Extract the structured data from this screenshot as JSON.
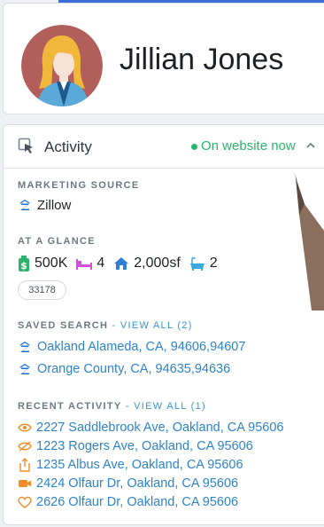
{
  "profile": {
    "name": "Jillian Jones"
  },
  "activity": {
    "title": "Activity",
    "status": "On website now",
    "status_color": "#29b36b",
    "marketing_source": {
      "label": "MARKETING SOURCE",
      "value": "Zillow",
      "icon": "zillow-icon"
    },
    "at_a_glance": {
      "label": "AT A GLANCE",
      "price": "500K",
      "beds": "4",
      "sqft": "2,000sf",
      "baths": "2",
      "zip": "33178"
    },
    "saved_search": {
      "label": "SAVED SEARCH",
      "view_all": " - VIEW ALL (2)",
      "items": [
        "Oakland Alameda, CA, 94606,94607",
        "Orange County, CA, 94635,94636"
      ]
    },
    "recent_activity": {
      "label": "RECENT ACTIVITY",
      "view_all": " - VIEW ALL (1)",
      "items": [
        {
          "icon": "eye-icon",
          "text": "2227 Saddlebrook Ave, Oakland, CA 95606"
        },
        {
          "icon": "eye-off-icon",
          "text": "1223 Rogers Ave, Oakland, CA 95606"
        },
        {
          "icon": "share-icon",
          "text": "1235 Albus Ave, Oakland, CA 95606"
        },
        {
          "icon": "video-icon",
          "text": "2424 Olfaur Dr, Oakland, CA 95606"
        },
        {
          "icon": "heart-icon",
          "text": "2626 Olfaur Dr, Oakland, CA 95606"
        }
      ]
    }
  },
  "colors": {
    "accent": "#2f83c8",
    "label": "#6c7886",
    "orange": "#f28c28",
    "price_green": "#2bb36a",
    "bed_pink": "#d04fd8",
    "home_blue": "#2f7fd8",
    "bath_cyan": "#3aa9e0"
  }
}
